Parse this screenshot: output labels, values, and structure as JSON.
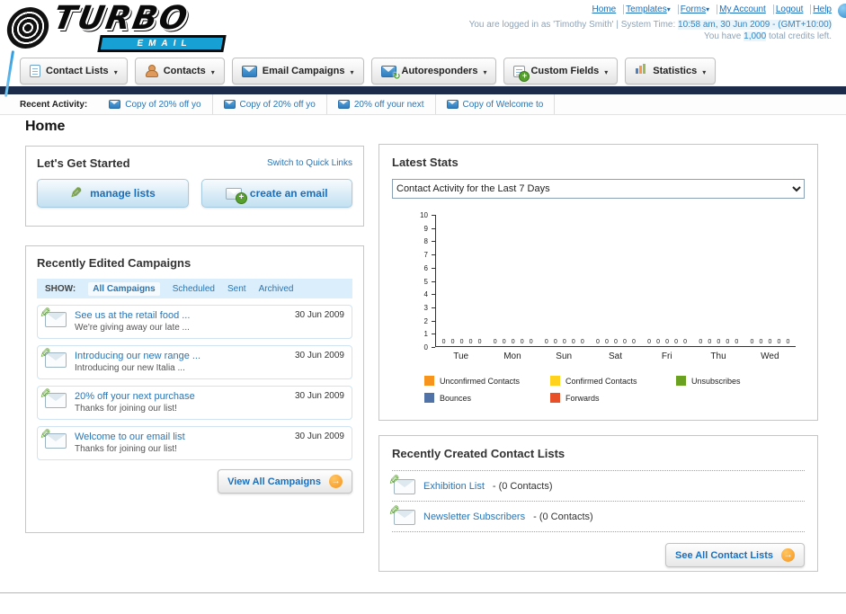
{
  "header": {
    "logo": {
      "line1": "TURBO",
      "line2": "EMAIL"
    },
    "top_links": [
      "Home",
      "Templates",
      "Forms",
      "My Account",
      "Logout",
      "Help"
    ],
    "login": {
      "prefix": "You are logged in as 'Timothy Smith' | System Time: ",
      "time": "10:58 am, 30 Jun 2009",
      "suffix": " - (GMT+10:00)"
    },
    "credits": {
      "prefix": "You have ",
      "amount": "1,000",
      "suffix": " total credits left."
    }
  },
  "nav": {
    "tabs": [
      {
        "label": "Contact Lists"
      },
      {
        "label": "Contacts"
      },
      {
        "label": "Email Campaigns"
      },
      {
        "label": "Autoresponders"
      },
      {
        "label": "Custom Fields"
      },
      {
        "label": "Statistics"
      }
    ]
  },
  "recent_activity": {
    "label": "Recent Activity:",
    "items": [
      "Copy of 20% off yo",
      "Copy of 20% off yo",
      "20% off your next",
      "Copy of Welcome to"
    ]
  },
  "page": {
    "title": "Home"
  },
  "get_started": {
    "title": "Let's Get Started",
    "switch_link": "Switch to Quick Links",
    "buttons": [
      {
        "label": "manage lists"
      },
      {
        "label": "create an email"
      }
    ]
  },
  "campaigns": {
    "title": "Recently Edited Campaigns",
    "show_label": "SHOW:",
    "filters": [
      "All Campaigns",
      "Scheduled",
      "Sent",
      "Archived"
    ],
    "active_filter": "All Campaigns",
    "items": [
      {
        "title": "See us at the retail food ...",
        "subtitle": "We're giving away our late ...",
        "date": "30 Jun 2009"
      },
      {
        "title": "Introducing our new range ...",
        "subtitle": "Introducing our new Italia ...",
        "date": "30 Jun 2009"
      },
      {
        "title": "20% off your next purchase",
        "subtitle": "Thanks for joining our list!",
        "date": "30 Jun 2009"
      },
      {
        "title": "Welcome to our email list",
        "subtitle": "Thanks for joining our list!",
        "date": "30 Jun 2009"
      }
    ],
    "view_all_label": "View All Campaigns"
  },
  "stats": {
    "title": "Latest Stats",
    "dropdown_value": "Contact Activity for the Last 7 Days",
    "chart_data": {
      "type": "bar",
      "title": "Contact Activity for the Last 7 Days",
      "categories": [
        "Tue",
        "Mon",
        "Sun",
        "Sat",
        "Fri",
        "Thu",
        "Wed"
      ],
      "series": [
        {
          "name": "Unconfirmed Contacts",
          "color": "#f7941d",
          "values": [
            0,
            0,
            0,
            0,
            0,
            0,
            0
          ]
        },
        {
          "name": "Confirmed Contacts",
          "color": "#ffd21e",
          "values": [
            0,
            0,
            0,
            0,
            0,
            0,
            0
          ]
        },
        {
          "name": "Unsubscribes",
          "color": "#6aa121",
          "values": [
            0,
            0,
            0,
            0,
            0,
            0,
            0
          ]
        },
        {
          "name": "Bounces",
          "color": "#5072a7",
          "values": [
            0,
            0,
            0,
            0,
            0,
            0,
            0
          ]
        },
        {
          "name": "Forwards",
          "color": "#e8502a",
          "values": [
            0,
            0,
            0,
            0,
            0,
            0,
            0
          ]
        }
      ],
      "xlabel": "",
      "ylabel": "",
      "ylim": [
        0,
        10
      ],
      "yticks": [
        0,
        1,
        2,
        3,
        4,
        5,
        6,
        7,
        8,
        9,
        10
      ],
      "grid": false,
      "legend_position": "bottom"
    }
  },
  "contact_lists": {
    "title": "Recently Created Contact Lists",
    "items": [
      {
        "name": "Exhibition List",
        "detail": "- (0 Contacts)"
      },
      {
        "name": "Newsletter Subscribers",
        "detail": "- (0 Contacts)"
      }
    ],
    "see_all_label": "See All Contact Lists"
  }
}
